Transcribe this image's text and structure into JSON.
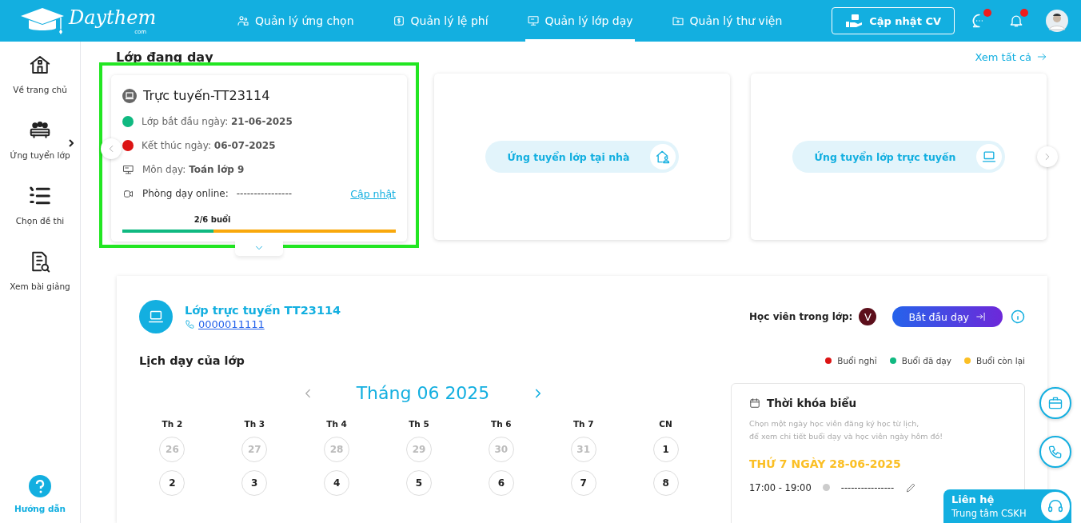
{
  "header": {
    "logo": {
      "name": "Daythem",
      "suffix": "com"
    },
    "nav": [
      {
        "label": "Quản lý ứng chọn",
        "selected": false
      },
      {
        "label": "Quản lý lệ phí",
        "selected": false
      },
      {
        "label": "Quản lý lớp dạy",
        "selected": true
      },
      {
        "label": "Quản lý thư viện",
        "selected": false
      }
    ],
    "cv_button": "Cập nhật CV",
    "messages_unread": true,
    "notifications_unread": true
  },
  "sidebar": {
    "items": [
      {
        "label": "Về trang chủ",
        "has_submenu": false
      },
      {
        "label": "Ứng tuyển lớp",
        "has_submenu": true
      },
      {
        "label": "Chọn đề thi",
        "has_submenu": false
      },
      {
        "label": "Xem bài giảng",
        "has_submenu": false
      }
    ],
    "help": "Hướng dẫn"
  },
  "teaching": {
    "title": "Lớp đang dạy",
    "see_all": "Xem tất cả",
    "class_card": {
      "highlighted": true,
      "title": "Trực tuyến-TT23114",
      "rows": [
        {
          "kind": "dot",
          "color": "#10b981",
          "label": "Lớp bắt đầu ngày:",
          "value": "21-06-2025"
        },
        {
          "kind": "dot",
          "color": "#dc1414",
          "label": "Kết thúc ngày:",
          "value": "06-07-2025"
        },
        {
          "kind": "subject",
          "label": "Môn dạy:",
          "value": "Toán lớp 9"
        }
      ],
      "room": {
        "label": "Phòng dạy online:",
        "value": "----------------",
        "action": "Cập nhật"
      },
      "progress": {
        "text": "2/6 buổi",
        "level": 0.333
      }
    },
    "apply_cards": [
      {
        "label": "Ứng tuyển lớp tại nhà"
      },
      {
        "label": "Ứng tuyển lớp trực tuyến"
      }
    ]
  },
  "detail": {
    "class_title": "Lớp trực tuyến TT23114",
    "phone": "0000011111",
    "students_label": "Học viên trong lớp:",
    "student_initial": "V",
    "start_button": "Bắt đầu dạy",
    "schedule_title": "Lịch dạy của lớp",
    "legend": [
      {
        "label": "Buổi nghỉ",
        "color": "#dc1414"
      },
      {
        "label": "Buổi đã dạy",
        "color": "#10b981"
      },
      {
        "label": "Buổi còn lại",
        "color": "#fbbf24"
      }
    ],
    "calendar": {
      "month": "Tháng 06 2025",
      "weekdays": [
        "Th 2",
        "Th 3",
        "Th 4",
        "Th 5",
        "Th 6",
        "Th 7",
        "CN"
      ],
      "weeks": [
        [
          {
            "day": "26",
            "muted": true
          },
          {
            "day": "27",
            "muted": true
          },
          {
            "day": "28",
            "muted": true
          },
          {
            "day": "29",
            "muted": true
          },
          {
            "day": "30",
            "muted": true
          },
          {
            "day": "31",
            "muted": true
          },
          {
            "day": "1",
            "muted": false
          }
        ],
        [
          {
            "day": "2",
            "muted": false
          },
          {
            "day": "3",
            "muted": false
          },
          {
            "day": "4",
            "muted": false
          },
          {
            "day": "5",
            "muted": false
          },
          {
            "day": "6",
            "muted": false
          },
          {
            "day": "7",
            "muted": false
          },
          {
            "day": "8",
            "muted": false
          }
        ]
      ]
    },
    "timetable": {
      "title": "Thời khóa biểu",
      "hint": "Chọn một ngày học viên đăng ký học từ lịch,\nđể xem chi tiết buổi dạy và học viên ngày hôm đó!",
      "date": "THỨ 7 NGÀY 28-06-2025",
      "sessions": [
        {
          "time": "17:00 - 19:00",
          "room": "----------------"
        }
      ]
    }
  },
  "contact": {
    "title": "Liên hệ",
    "subtitle": "Trung tâm CSKH"
  }
}
